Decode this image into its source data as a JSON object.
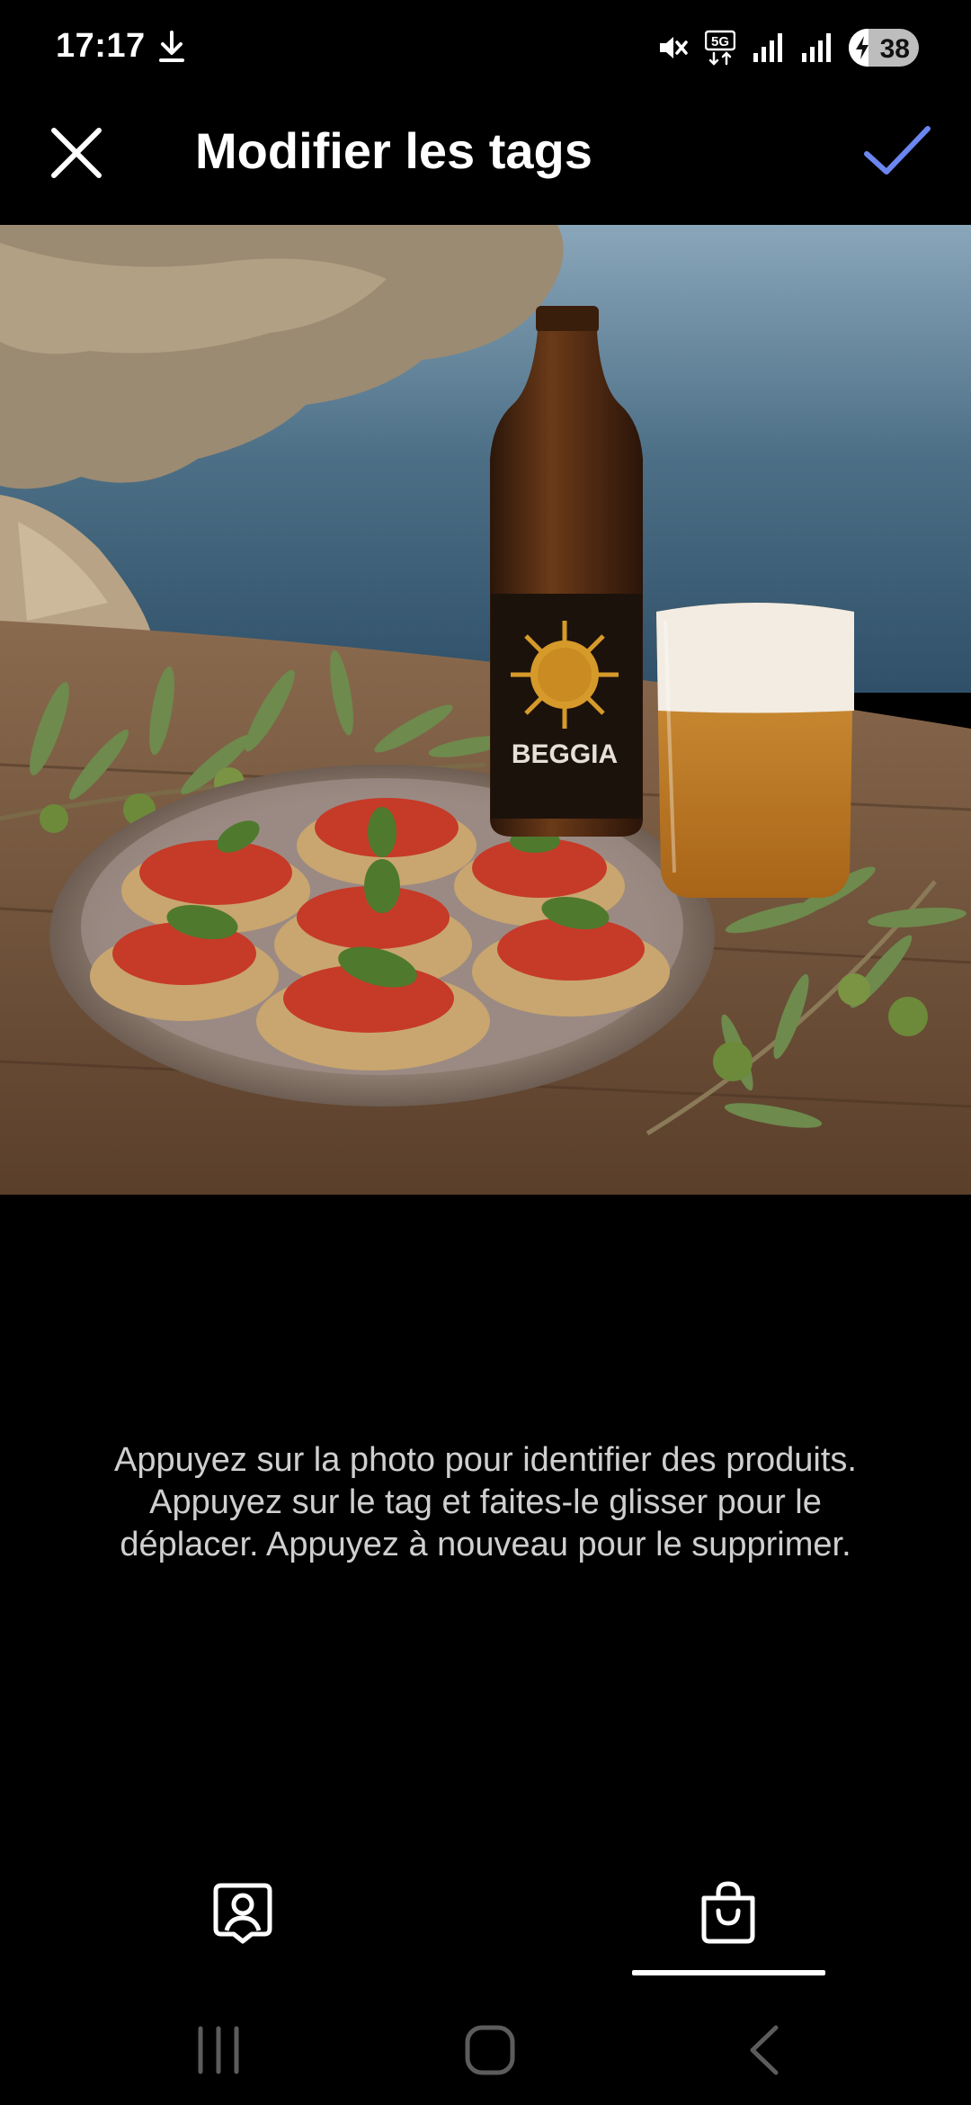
{
  "status_bar": {
    "time": "17:17",
    "network": "5G",
    "battery_level": "38",
    "icons": [
      "download-icon",
      "mute-icon",
      "5g-icon",
      "signal-icon",
      "battery-icon"
    ]
  },
  "header": {
    "title": "Modifier les tags",
    "close_icon": "close-icon",
    "confirm_icon": "checkmark-icon",
    "accent_color": "#6b86f0"
  },
  "photo": {
    "bottle_label": "BEGGIA"
  },
  "instructions": {
    "text": "Appuyez sur la photo pour identifier des produits. Appuyez sur le tag et faites-le glisser pour le déplacer. Appuyez à nouveau pour le supprimer."
  },
  "tabs": {
    "items": [
      {
        "icon": "tag-people-icon",
        "selected": false
      },
      {
        "icon": "shopping-bag-icon",
        "selected": true
      }
    ]
  },
  "nav": {
    "icons": [
      "recents-icon",
      "home-icon",
      "back-icon"
    ]
  }
}
